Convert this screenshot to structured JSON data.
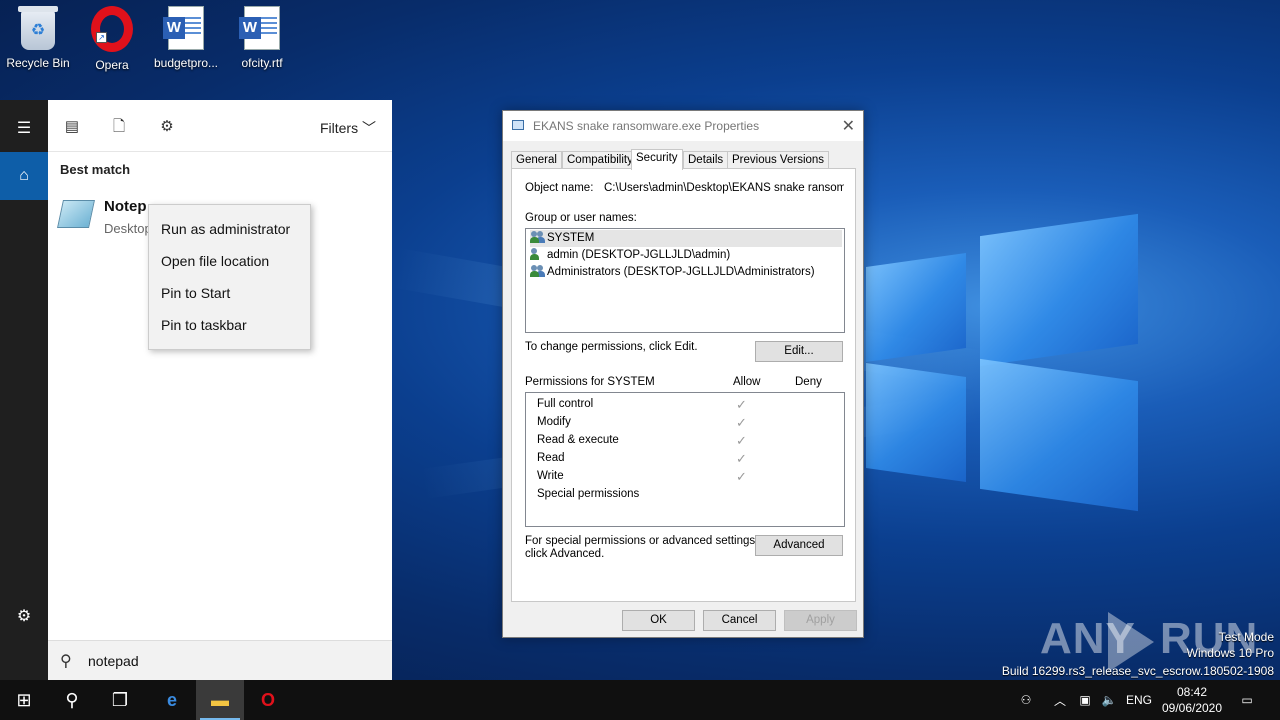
{
  "desktop": {
    "icons": [
      {
        "label": "Recycle Bin",
        "icon": "recycle-bin-icon"
      },
      {
        "label": "Opera",
        "icon": "opera-icon"
      },
      {
        "label": "budgetpro...",
        "icon": "word-doc-icon"
      },
      {
        "label": "ofcity.rtf",
        "icon": "word-doc-icon"
      }
    ]
  },
  "start_menu": {
    "filters_label": "Filters",
    "best_match_label": "Best match",
    "result": {
      "title": "Notepad",
      "title_visible": "Notep",
      "subtitle": "Desktop"
    },
    "search_value": "notepad",
    "context_menu": [
      "Run as administrator",
      "Open file location",
      "Pin to Start",
      "Pin to taskbar"
    ]
  },
  "dialog": {
    "title": "EKANS snake ransomware.exe Properties",
    "tabs": [
      "General",
      "Compatibility",
      "Security",
      "Details",
      "Previous Versions"
    ],
    "active_tab": "Security",
    "object_name_label": "Object name:",
    "object_name_value": "C:\\Users\\admin\\Desktop\\EKANS snake ransomw...",
    "group_label": "Group or user names:",
    "groups": [
      "SYSTEM",
      "admin (DESKTOP-JGLLJLD\\admin)",
      "Administrators (DESKTOP-JGLLJLD\\Administrators)"
    ],
    "change_text": "To change permissions, click Edit.",
    "edit_button": "Edit...",
    "permissions_for": "Permissions for SYSTEM",
    "allow_label": "Allow",
    "deny_label": "Deny",
    "permissions": [
      {
        "name": "Full control",
        "allow": "✓"
      },
      {
        "name": "Modify",
        "allow": "✓"
      },
      {
        "name": "Read & execute",
        "allow": "✓"
      },
      {
        "name": "Read",
        "allow": "✓"
      },
      {
        "name": "Write",
        "allow": "✓"
      },
      {
        "name": "Special permissions",
        "allow": ""
      }
    ],
    "special_text_1": "For special permissions or advanced settings,",
    "special_text_2": "click Advanced.",
    "advanced_button": "Advanced",
    "ok_button": "OK",
    "cancel_button": "Cancel",
    "apply_button": "Apply"
  },
  "watermark": {
    "brand_left": "ANY",
    "brand_right": "RUN",
    "line1": "Test Mode",
    "line2": "Windows 10 Pro",
    "line3": "Build 16299.rs3_release_svc_escrow.180502-1908"
  },
  "taskbar": {
    "lang": "ENG",
    "time": "08:42",
    "date": "09/06/2020"
  },
  "colors": {
    "accent": "#0e5ea8",
    "taskbar": "#101010",
    "opera_red": "#e0111b"
  }
}
